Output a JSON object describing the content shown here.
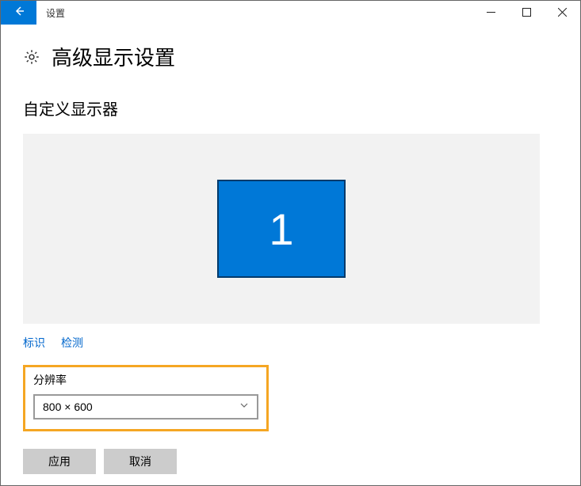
{
  "titlebar": {
    "title": "设置"
  },
  "page": {
    "heading": "高级显示设置",
    "section": "自定义显示器"
  },
  "monitor": {
    "number": "1"
  },
  "links": {
    "identify": "标识",
    "detect": "检测"
  },
  "resolution": {
    "label": "分辨率",
    "value": "800 × 600"
  },
  "buttons": {
    "apply": "应用",
    "cancel": "取消"
  }
}
